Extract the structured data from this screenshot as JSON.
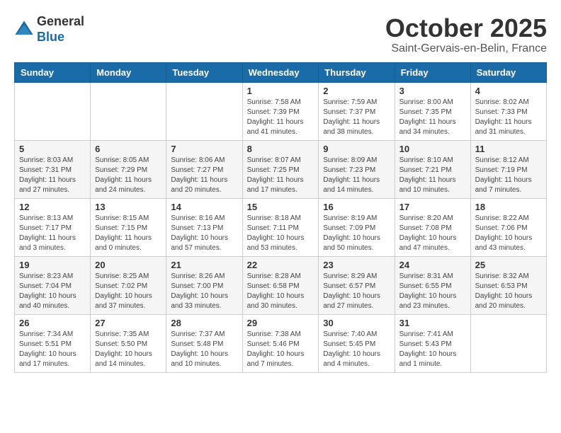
{
  "header": {
    "logo_line1": "General",
    "logo_line2": "Blue",
    "month": "October 2025",
    "location": "Saint-Gervais-en-Belin, France"
  },
  "days_of_week": [
    "Sunday",
    "Monday",
    "Tuesday",
    "Wednesday",
    "Thursday",
    "Friday",
    "Saturday"
  ],
  "weeks": [
    [
      {
        "day": "",
        "info": ""
      },
      {
        "day": "",
        "info": ""
      },
      {
        "day": "",
        "info": ""
      },
      {
        "day": "1",
        "info": "Sunrise: 7:58 AM\nSunset: 7:39 PM\nDaylight: 11 hours\nand 41 minutes."
      },
      {
        "day": "2",
        "info": "Sunrise: 7:59 AM\nSunset: 7:37 PM\nDaylight: 11 hours\nand 38 minutes."
      },
      {
        "day": "3",
        "info": "Sunrise: 8:00 AM\nSunset: 7:35 PM\nDaylight: 11 hours\nand 34 minutes."
      },
      {
        "day": "4",
        "info": "Sunrise: 8:02 AM\nSunset: 7:33 PM\nDaylight: 11 hours\nand 31 minutes."
      }
    ],
    [
      {
        "day": "5",
        "info": "Sunrise: 8:03 AM\nSunset: 7:31 PM\nDaylight: 11 hours\nand 27 minutes."
      },
      {
        "day": "6",
        "info": "Sunrise: 8:05 AM\nSunset: 7:29 PM\nDaylight: 11 hours\nand 24 minutes."
      },
      {
        "day": "7",
        "info": "Sunrise: 8:06 AM\nSunset: 7:27 PM\nDaylight: 11 hours\nand 20 minutes."
      },
      {
        "day": "8",
        "info": "Sunrise: 8:07 AM\nSunset: 7:25 PM\nDaylight: 11 hours\nand 17 minutes."
      },
      {
        "day": "9",
        "info": "Sunrise: 8:09 AM\nSunset: 7:23 PM\nDaylight: 11 hours\nand 14 minutes."
      },
      {
        "day": "10",
        "info": "Sunrise: 8:10 AM\nSunset: 7:21 PM\nDaylight: 11 hours\nand 10 minutes."
      },
      {
        "day": "11",
        "info": "Sunrise: 8:12 AM\nSunset: 7:19 PM\nDaylight: 11 hours\nand 7 minutes."
      }
    ],
    [
      {
        "day": "12",
        "info": "Sunrise: 8:13 AM\nSunset: 7:17 PM\nDaylight: 11 hours\nand 3 minutes."
      },
      {
        "day": "13",
        "info": "Sunrise: 8:15 AM\nSunset: 7:15 PM\nDaylight: 11 hours\nand 0 minutes."
      },
      {
        "day": "14",
        "info": "Sunrise: 8:16 AM\nSunset: 7:13 PM\nDaylight: 10 hours\nand 57 minutes."
      },
      {
        "day": "15",
        "info": "Sunrise: 8:18 AM\nSunset: 7:11 PM\nDaylight: 10 hours\nand 53 minutes."
      },
      {
        "day": "16",
        "info": "Sunrise: 8:19 AM\nSunset: 7:09 PM\nDaylight: 10 hours\nand 50 minutes."
      },
      {
        "day": "17",
        "info": "Sunrise: 8:20 AM\nSunset: 7:08 PM\nDaylight: 10 hours\nand 47 minutes."
      },
      {
        "day": "18",
        "info": "Sunrise: 8:22 AM\nSunset: 7:06 PM\nDaylight: 10 hours\nand 43 minutes."
      }
    ],
    [
      {
        "day": "19",
        "info": "Sunrise: 8:23 AM\nSunset: 7:04 PM\nDaylight: 10 hours\nand 40 minutes."
      },
      {
        "day": "20",
        "info": "Sunrise: 8:25 AM\nSunset: 7:02 PM\nDaylight: 10 hours\nand 37 minutes."
      },
      {
        "day": "21",
        "info": "Sunrise: 8:26 AM\nSunset: 7:00 PM\nDaylight: 10 hours\nand 33 minutes."
      },
      {
        "day": "22",
        "info": "Sunrise: 8:28 AM\nSunset: 6:58 PM\nDaylight: 10 hours\nand 30 minutes."
      },
      {
        "day": "23",
        "info": "Sunrise: 8:29 AM\nSunset: 6:57 PM\nDaylight: 10 hours\nand 27 minutes."
      },
      {
        "day": "24",
        "info": "Sunrise: 8:31 AM\nSunset: 6:55 PM\nDaylight: 10 hours\nand 23 minutes."
      },
      {
        "day": "25",
        "info": "Sunrise: 8:32 AM\nSunset: 6:53 PM\nDaylight: 10 hours\nand 20 minutes."
      }
    ],
    [
      {
        "day": "26",
        "info": "Sunrise: 7:34 AM\nSunset: 5:51 PM\nDaylight: 10 hours\nand 17 minutes."
      },
      {
        "day": "27",
        "info": "Sunrise: 7:35 AM\nSunset: 5:50 PM\nDaylight: 10 hours\nand 14 minutes."
      },
      {
        "day": "28",
        "info": "Sunrise: 7:37 AM\nSunset: 5:48 PM\nDaylight: 10 hours\nand 10 minutes."
      },
      {
        "day": "29",
        "info": "Sunrise: 7:38 AM\nSunset: 5:46 PM\nDaylight: 10 hours\nand 7 minutes."
      },
      {
        "day": "30",
        "info": "Sunrise: 7:40 AM\nSunset: 5:45 PM\nDaylight: 10 hours\nand 4 minutes."
      },
      {
        "day": "31",
        "info": "Sunrise: 7:41 AM\nSunset: 5:43 PM\nDaylight: 10 hours\nand 1 minute."
      },
      {
        "day": "",
        "info": ""
      }
    ]
  ]
}
